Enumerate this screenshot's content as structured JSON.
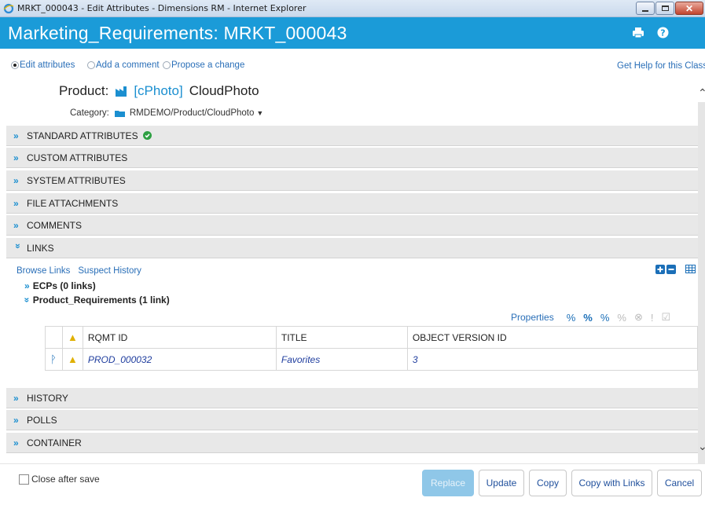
{
  "window": {
    "title": "MRKT_000043 - Edit Attributes - Dimensions RM - Internet Explorer"
  },
  "header": {
    "title": "Marketing_Requirements: MRKT_000043",
    "icons": [
      "print-icon",
      "help-icon"
    ]
  },
  "mode": {
    "options": [
      {
        "label": "Edit attributes",
        "selected": true
      },
      {
        "label": "Add a comment",
        "selected": false
      },
      {
        "label": "Propose a change",
        "selected": false
      }
    ],
    "help_link": "Get Help for this Class"
  },
  "product": {
    "label": "Product:",
    "id": "[cPhoto]",
    "name": "CloudPhoto",
    "category_label": "Category:",
    "category_value": "RMDEMO/Product/CloudPhoto"
  },
  "sections": {
    "standard": "STANDARD ATTRIBUTES",
    "custom": "CUSTOM ATTRIBUTES",
    "system": "SYSTEM ATTRIBUTES",
    "files": "FILE ATTACHMENTS",
    "comments": "COMMENTS",
    "links": "LINKS",
    "history": "HISTORY",
    "polls": "POLLS",
    "container": "CONTAINER"
  },
  "links_panel": {
    "browse": "Browse Links",
    "suspect": "Suspect History",
    "groups": [
      "ECPs (0 links)",
      "Product_Requirements (1 link)"
    ],
    "properties": "Properties",
    "table": {
      "headers": [
        "RQMT ID",
        "TITLE",
        "OBJECT VERSION ID"
      ],
      "rows": [
        {
          "rqmt_id": "PROD_000032",
          "title": "Favorites",
          "version": "3"
        }
      ]
    }
  },
  "footer": {
    "close_after_save": "Close after save",
    "buttons": {
      "replace": "Replace",
      "update": "Update",
      "copy": "Copy",
      "copy_links": "Copy with Links",
      "cancel": "Cancel"
    }
  },
  "colors": {
    "header_blue": "#1b9bd8",
    "link_blue": "#2a6fb8",
    "section_gray": "#e8e8e8"
  }
}
